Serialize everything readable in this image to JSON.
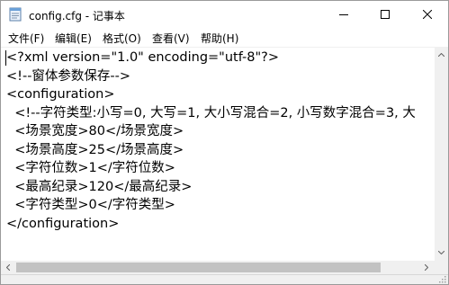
{
  "window": {
    "title": "config.cfg - 记事本"
  },
  "menu": {
    "items": [
      {
        "label": "文件(F)"
      },
      {
        "label": "编辑(E)"
      },
      {
        "label": "格式(O)"
      },
      {
        "label": "查看(V)"
      },
      {
        "label": "帮助(H)"
      }
    ]
  },
  "editor": {
    "lines": [
      "<?xml version=\"1.0\" encoding=\"utf-8\"?>",
      "<!--窗体参数保存-->",
      "<configuration>",
      "  <!--字符类型:小写=0, 大写=1, 大小写混合=2, 小写数字混合=3, 大",
      "  <场景宽度>80</场景宽度>",
      "  <场景高度>25</场景高度>",
      "  <字符位数>1</字符位数>",
      "  <最高纪录>120</最高纪录>",
      "  <字符类型>0</字符类型>",
      "</configuration>"
    ]
  },
  "icons": {
    "app": "notepad-icon",
    "minimize": "minimize-icon",
    "maximize": "maximize-icon",
    "close": "close-icon"
  },
  "colors": {
    "scrollbar_track": "#f0f0f0",
    "scrollbar_thumb": "#c2c2c2",
    "text": "#000000"
  }
}
